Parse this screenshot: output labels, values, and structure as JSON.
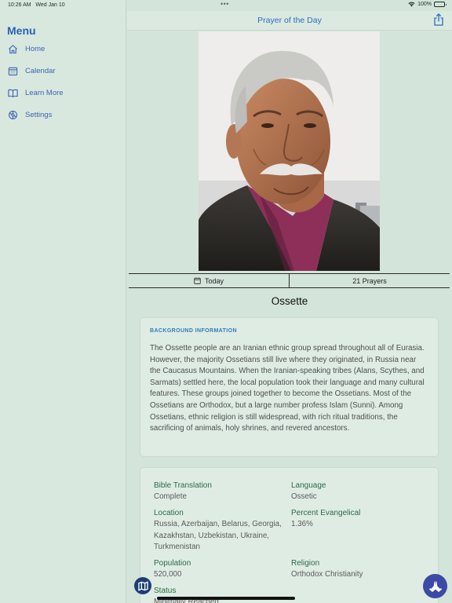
{
  "status_bar": {
    "time": "10:26 AM",
    "date": "Wed Jan 10",
    "battery": "100%",
    "battery_level": 1.0
  },
  "sidebar": {
    "title": "Menu",
    "items": [
      {
        "label": "Home",
        "icon": "home-icon"
      },
      {
        "label": "Calendar",
        "icon": "calendar-icon"
      },
      {
        "label": "Learn More",
        "icon": "book-icon"
      },
      {
        "label": "Settings",
        "icon": "gear-icon"
      }
    ]
  },
  "header": {
    "title": "Prayer of the Day",
    "share_icon": "share-icon"
  },
  "tabs": [
    {
      "label": "Today",
      "icon": "calendar-icon"
    },
    {
      "label": "21 Prayers"
    }
  ],
  "people_group": {
    "name": "Ossette"
  },
  "background": {
    "heading": "BACKGROUND INFORMATION",
    "text": "The Ossette people are an Iranian ethnic group spread throughout all of Eurasia. However, the majority Ossetians still live where they originated, in Russia near the Caucasus Mountains. When the Iranian-speaking tribes (Alans, Scythes, and Sarmats) settled here, the local population took their language and many cultural features. These groups joined together to become the Ossetians. Most of the Ossetians are Orthodox, but a large number profess Islam (Sunni). Among Ossetians, ethnic religion is still widespread, with rich ritual traditions, the sacrificing of animals, holy shrines, and revered ancestors."
  },
  "facts": {
    "bible_translation": {
      "label": "Bible Translation",
      "value": "Complete"
    },
    "language": {
      "label": "Language",
      "value": "Ossetic"
    },
    "location": {
      "label": "Location",
      "value": "Russia, Azerbaijan, Belarus, Georgia, Kazakhstan, Uzbekistan, Ukraine, Turkmenistan"
    },
    "percent_evangelical": {
      "label": "Percent Evangelical",
      "value": "1.36%"
    },
    "population": {
      "label": "Population",
      "value": "520,000"
    },
    "religion": {
      "label": "Religion",
      "value": "Orthodox Christianity"
    },
    "status": {
      "label": "Status",
      "value": "Minimally Reached"
    }
  },
  "buttons": {
    "map_icon": "map-icon",
    "pray_icon": "praying-hands-icon"
  },
  "colors": {
    "accent": "#2c6fb8",
    "menu_title": "#2a5fb5",
    "fact_label": "#2c6a43",
    "background": "#d3e4da"
  }
}
